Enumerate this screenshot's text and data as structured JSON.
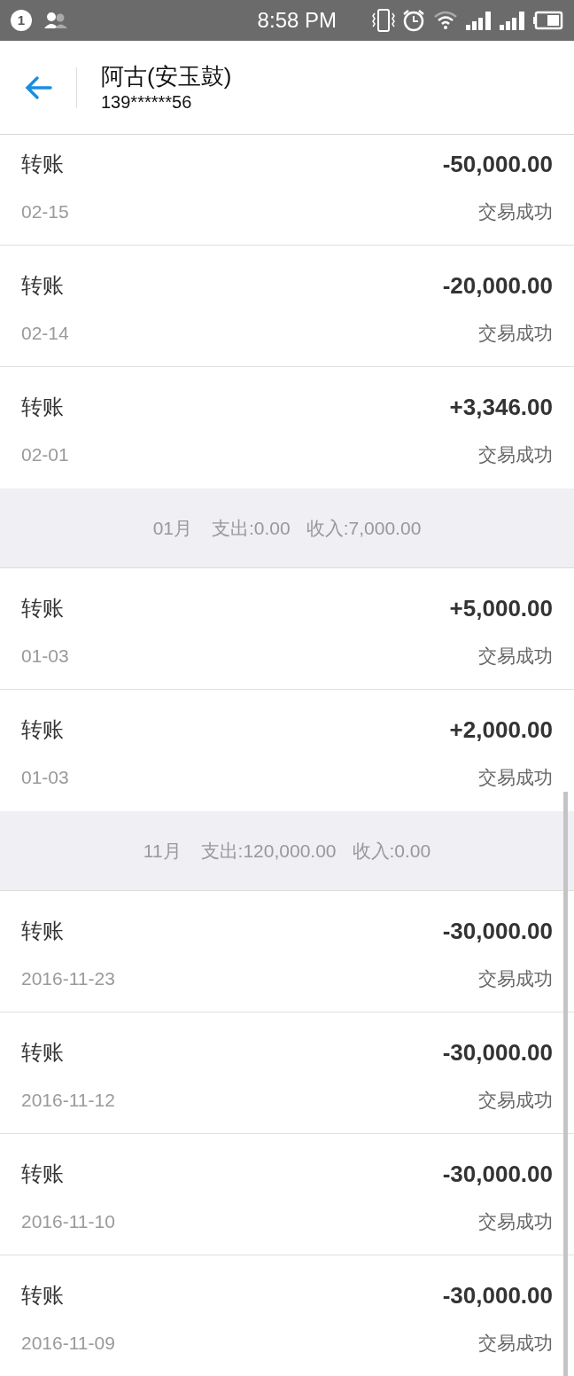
{
  "status_bar": {
    "notification_count": "1",
    "time": "8:58 PM"
  },
  "header": {
    "title": "阿古(安玉鼓)",
    "subtitle": "139******56"
  },
  "list": [
    {
      "kind": "transaction",
      "title": "转账",
      "amount": "-50,000.00",
      "date": "02-15",
      "status": "交易成功"
    },
    {
      "kind": "transaction",
      "title": "转账",
      "amount": "-20,000.00",
      "date": "02-14",
      "status": "交易成功"
    },
    {
      "kind": "transaction",
      "title": "转账",
      "amount": "+3,346.00",
      "date": "02-01",
      "status": "交易成功"
    },
    {
      "kind": "month",
      "month": "01月",
      "expense": "支出:0.00",
      "income": "收入:7,000.00"
    },
    {
      "kind": "transaction",
      "title": "转账",
      "amount": "+5,000.00",
      "date": "01-03",
      "status": "交易成功"
    },
    {
      "kind": "transaction",
      "title": "转账",
      "amount": "+2,000.00",
      "date": "01-03",
      "status": "交易成功"
    },
    {
      "kind": "month",
      "month": "11月",
      "expense": "支出:120,000.00",
      "income": "收入:0.00"
    },
    {
      "kind": "transaction",
      "title": "转账",
      "amount": "-30,000.00",
      "date": "2016-11-23",
      "status": "交易成功"
    },
    {
      "kind": "transaction",
      "title": "转账",
      "amount": "-30,000.00",
      "date": "2016-11-12",
      "status": "交易成功"
    },
    {
      "kind": "transaction",
      "title": "转账",
      "amount": "-30,000.00",
      "date": "2016-11-10",
      "status": "交易成功"
    },
    {
      "kind": "transaction",
      "title": "转账",
      "amount": "-30,000.00",
      "date": "2016-11-09",
      "status": "交易成功"
    }
  ]
}
